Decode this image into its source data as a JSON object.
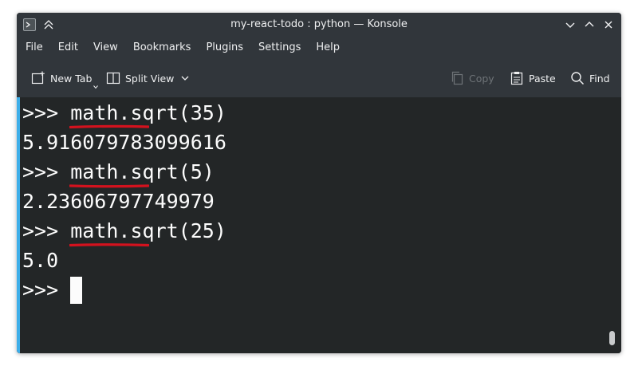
{
  "window": {
    "title": "my-react-todo : python — Konsole"
  },
  "menubar": {
    "items": [
      "File",
      "Edit",
      "View",
      "Bookmarks",
      "Plugins",
      "Settings",
      "Help"
    ]
  },
  "toolbar": {
    "new_tab_label": "New Tab",
    "split_view_label": "Split View",
    "copy_label": "Copy",
    "paste_label": "Paste",
    "find_label": "Find"
  },
  "terminal": {
    "prompt": ">>> ",
    "lines": [
      {
        "kind": "input",
        "text": "math.sqrt(35)"
      },
      {
        "kind": "output",
        "text": "5.916079783099616"
      },
      {
        "kind": "input",
        "text": "math.sqrt(5)"
      },
      {
        "kind": "output",
        "text": "2.23606797749979"
      },
      {
        "kind": "input",
        "text": "math.sqrt(25)"
      },
      {
        "kind": "output",
        "text": "5.0"
      }
    ]
  },
  "colors": {
    "terminal_bg": "#232627",
    "chrome_bg": "#31363b",
    "annotation_underline": "#d3121e",
    "focus_accent": "#3daee9"
  }
}
